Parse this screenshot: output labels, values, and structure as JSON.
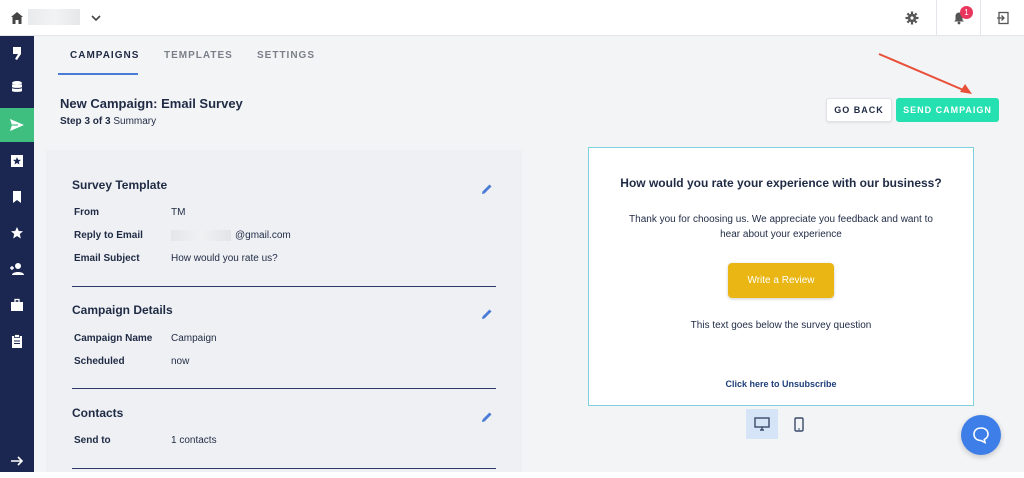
{
  "topbar": {
    "notification_count": "1"
  },
  "sidebar": {
    "items": [
      "logo-icon",
      "database-icon",
      "send-icon",
      "star-box-icon",
      "bookmark-icon",
      "star-icon",
      "add-user-icon",
      "briefcase-icon",
      "clipboard-icon",
      "arrow-right-icon"
    ],
    "active_index": 2
  },
  "tabs": [
    "CAMPAIGNS",
    "TEMPLATES",
    "SETTINGS"
  ],
  "header": {
    "title": "New Campaign: Email Survey",
    "step_bold": "Step 3 of 3",
    "step_rest": " Summary"
  },
  "actions": {
    "back": "GO BACK",
    "send": "SEND CAMPAIGN"
  },
  "survey_template": {
    "title": "Survey Template",
    "rows": [
      {
        "label": "From",
        "value": "TM"
      },
      {
        "label": "Reply to Email",
        "value": "@gmail.com"
      },
      {
        "label": "Email Subject",
        "value": "How would you rate us?"
      }
    ]
  },
  "campaign_details": {
    "title": "Campaign Details",
    "rows": [
      {
        "label": "Campaign Name",
        "value": "Campaign"
      },
      {
        "label": "Scheduled",
        "value": "now"
      }
    ]
  },
  "contacts": {
    "title": "Contacts",
    "rows": [
      {
        "label": "Send to",
        "value": "1 contacts"
      }
    ]
  },
  "preview": {
    "question": "How would you rate your experience with our business?",
    "thanks": "Thank you for choosing us. We appreciate you feedback and want to hear about your experience",
    "button": "Write a Review",
    "below": "This text goes below the survey question",
    "unsubscribe": "Click here to Unsubscribe"
  },
  "colors": {
    "accent": "#25e0b0",
    "sidebar": "#1b2750",
    "active": "#3fbf7f",
    "review_button": "#e9b613",
    "arrow": "#e8503a"
  }
}
